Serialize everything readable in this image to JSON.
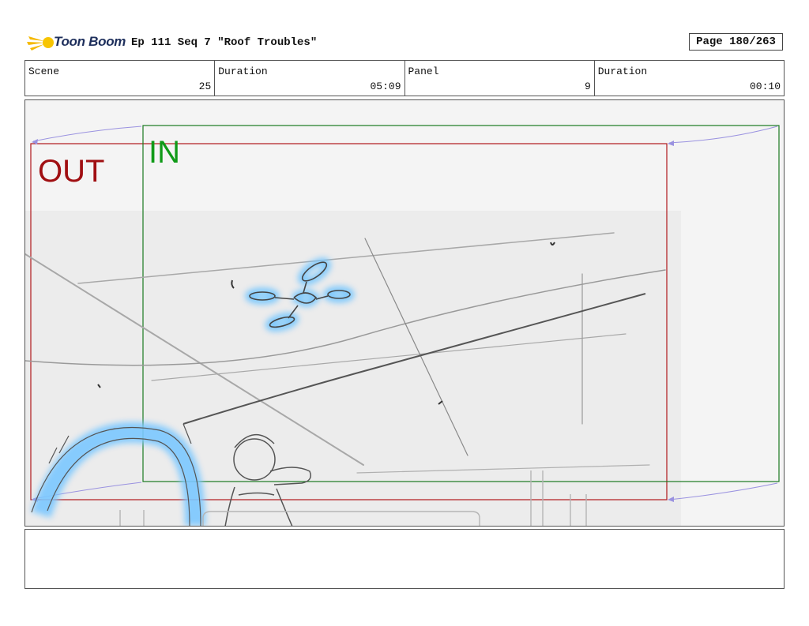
{
  "header": {
    "logo_text": "Toon Boom",
    "title": "Ep 111 Seq 7 \"Roof Troubles\"",
    "page": "Page 180/263"
  },
  "info": {
    "scene_label": "Scene",
    "scene_value": "25",
    "duration_label": "Duration",
    "duration_value": "05:09",
    "panel_label": "Panel",
    "panel_value": "9",
    "panel_duration_label": "Duration",
    "panel_duration_value": "00:10"
  },
  "panel": {
    "out_label": "OUT",
    "in_label": "IN",
    "out_color": "#a00f12",
    "in_color": "#109a18"
  },
  "notes": {
    "text": ""
  }
}
